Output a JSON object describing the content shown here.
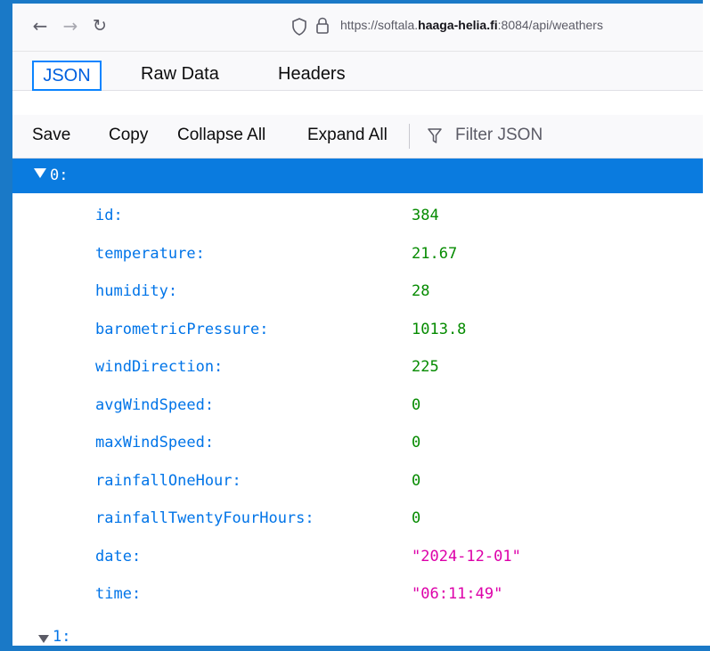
{
  "browser": {
    "url_prefix": "https://softala.",
    "url_domain": "haaga-helia.fi",
    "url_suffix": ":8084/api/weathers"
  },
  "tabs": [
    {
      "label": "JSON",
      "active": true
    },
    {
      "label": "Raw Data",
      "active": false
    },
    {
      "label": "Headers",
      "active": false
    }
  ],
  "toolbar": {
    "save_label": "Save",
    "copy_label": "Copy",
    "collapse_label": "Collapse All",
    "expand_label": "Expand All",
    "filter_placeholder": "Filter JSON"
  },
  "json": {
    "item0_label": "0:",
    "item1_label": "1:",
    "fields": [
      {
        "key": "id:",
        "value": "384",
        "type": "number"
      },
      {
        "key": "temperature:",
        "value": "21.67",
        "type": "number"
      },
      {
        "key": "humidity:",
        "value": "28",
        "type": "number"
      },
      {
        "key": "barometricPressure:",
        "value": "1013.8",
        "type": "number"
      },
      {
        "key": "windDirection:",
        "value": "225",
        "type": "number"
      },
      {
        "key": "avgWindSpeed:",
        "value": "0",
        "type": "number"
      },
      {
        "key": "maxWindSpeed:",
        "value": "0",
        "type": "number"
      },
      {
        "key": "rainfallOneHour:",
        "value": "0",
        "type": "number"
      },
      {
        "key": "rainfallTwentyFourHours:",
        "value": "0",
        "type": "number"
      },
      {
        "key": "date:",
        "value": "\"2024-12-01\"",
        "type": "string"
      },
      {
        "key": "time:",
        "value": "\"06:11:49\"",
        "type": "string"
      }
    ]
  },
  "colors": {
    "accent": "#0a84ff",
    "selected_row": "#0a7bdf",
    "key": "#0074e8",
    "number": "#058b00",
    "string": "#dd00a9"
  }
}
